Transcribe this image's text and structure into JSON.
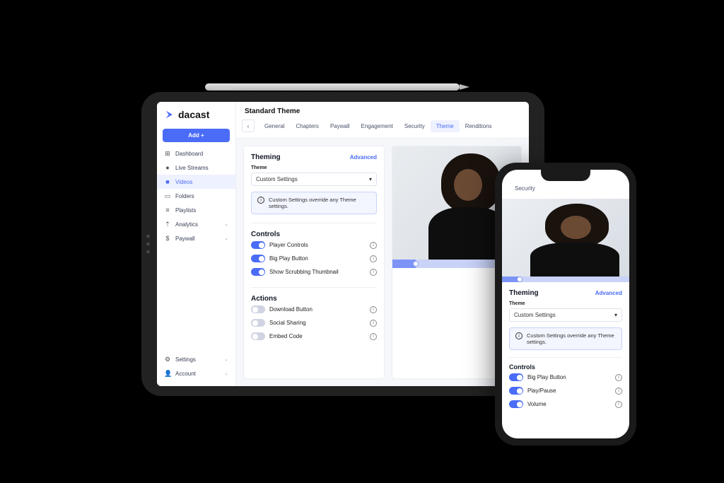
{
  "brand": {
    "name": "dacast"
  },
  "sidebar": {
    "add_label": "Add +",
    "items": [
      {
        "icon": "⊞",
        "label": "Dashboard"
      },
      {
        "icon": "●",
        "label": "Live Streams"
      },
      {
        "icon": "■",
        "label": "Videos",
        "active": true
      },
      {
        "icon": "▭",
        "label": "Folders"
      },
      {
        "icon": "≡",
        "label": "Playlists"
      },
      {
        "icon": "⇡",
        "label": "Analytics",
        "expandable": true
      },
      {
        "icon": "$",
        "label": "Paywall",
        "expandable": true
      }
    ],
    "bottom": [
      {
        "icon": "⚙",
        "label": "Settings",
        "expandable": true
      },
      {
        "icon": "👤",
        "label": "Account",
        "expandable": true
      }
    ]
  },
  "page": {
    "title": "Standard Theme",
    "tabs": [
      "General",
      "Chapters",
      "Paywall",
      "Engagement",
      "Security",
      "Theme",
      "Renditions"
    ],
    "active_tab": "Theme"
  },
  "theming": {
    "section_title": "Theming",
    "advanced_label": "Advanced",
    "field_label": "Theme",
    "select_value": "Custom Settings",
    "notice": "Custom Settings override any Theme settings."
  },
  "controls": {
    "section_title": "Controls",
    "items": [
      {
        "label": "Player Controls",
        "on": true
      },
      {
        "label": "Big Play Button",
        "on": true
      },
      {
        "label": "Show Scrubbing Thumbnail",
        "on": true
      }
    ]
  },
  "actions": {
    "section_title": "Actions",
    "items": [
      {
        "label": "Download Button",
        "on": false
      },
      {
        "label": "Social Sharing",
        "on": false
      },
      {
        "label": "Embed Code",
        "on": false
      }
    ]
  },
  "phone": {
    "tab": "Security",
    "theming_title": "Theming",
    "advanced_label": "Advanced",
    "field_label": "Theme",
    "select_value": "Custom Settings",
    "notice": "Custom Settings override any Theme settings.",
    "controls_title": "Controls",
    "controls": [
      {
        "label": "Big Play Button",
        "on": true
      },
      {
        "label": "Play/Pause",
        "on": true
      },
      {
        "label": "Volume",
        "on": true
      }
    ]
  }
}
